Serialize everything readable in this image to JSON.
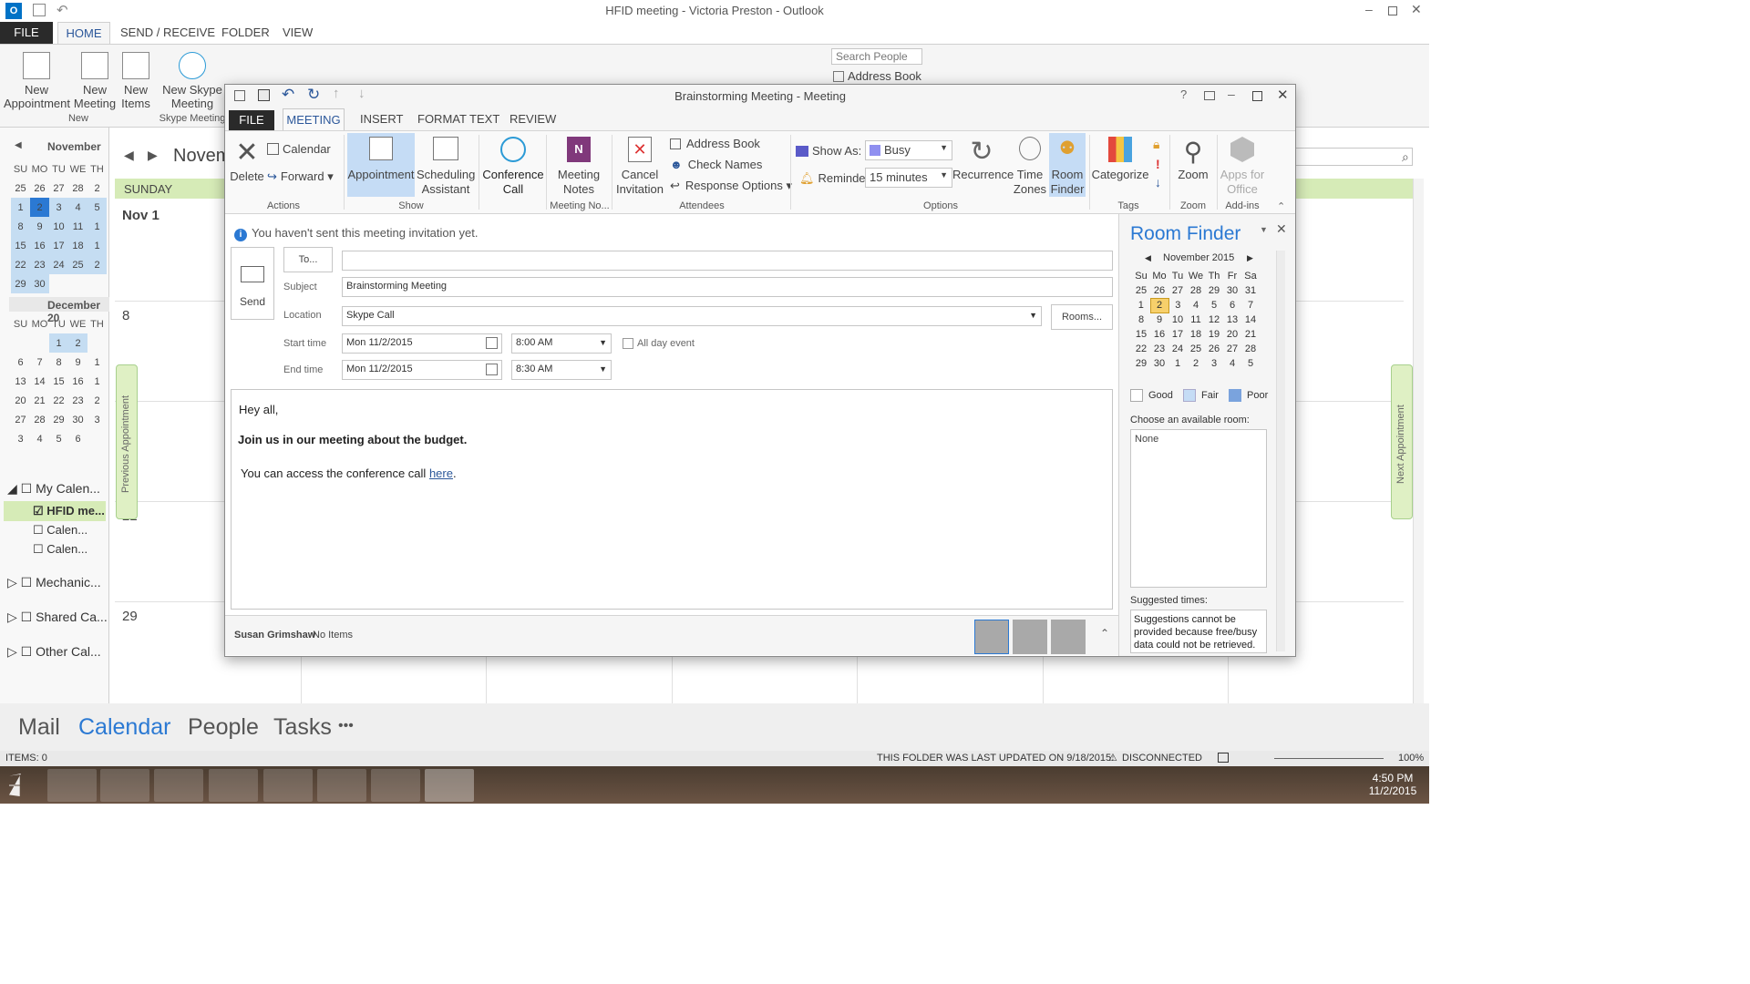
{
  "outlook": {
    "window_title": "HFID meeting - Victoria Preston - Outlook",
    "tabs": [
      "FILE",
      "HOME",
      "SEND / RECEIVE",
      "FOLDER",
      "VIEW"
    ],
    "ribbon": {
      "new_appointment": "New Appointment",
      "new_meeting": "New Meeting",
      "new_items": "New Items",
      "new_skype": "New Skype Meeting",
      "group_new": "New",
      "group_skype": "Skype Meeting",
      "search_people": "Search People",
      "address_book": "Address Book"
    },
    "nav_month1": "November",
    "nav_month2": "December 20",
    "day_headers": [
      "SU",
      "MO",
      "TU",
      "WE",
      "TH"
    ],
    "nov_weeks": [
      [
        "25",
        "26",
        "27",
        "28",
        "2"
      ],
      [
        "1",
        "2",
        "3",
        "4",
        "5"
      ],
      [
        "8",
        "9",
        "10",
        "11",
        "1"
      ],
      [
        "15",
        "16",
        "17",
        "18",
        "1"
      ],
      [
        "22",
        "23",
        "24",
        "25",
        "2"
      ],
      [
        "29",
        "30",
        "",
        "",
        ""
      ]
    ],
    "dec_weeks": [
      [
        "",
        "",
        "1",
        "2",
        ""
      ],
      [
        "6",
        "7",
        "8",
        "9",
        "1"
      ],
      [
        "13",
        "14",
        "15",
        "16",
        "1"
      ],
      [
        "20",
        "21",
        "22",
        "23",
        "2"
      ],
      [
        "27",
        "28",
        "29",
        "30",
        "3"
      ],
      [
        "3",
        "4",
        "5",
        "6",
        ""
      ]
    ],
    "calendars": {
      "my": "My Calen...",
      "hfid": "HFID me...",
      "cal1": "Calen...",
      "cal2": "Calen...",
      "mech": "Mechanic...",
      "shared": "Shared Ca...",
      "other": "Other Cal..."
    },
    "cal_month": "Novem",
    "sunday": "SUNDAY",
    "dates": [
      "Nov 1",
      "8",
      "22",
      "29"
    ],
    "prev_appt": "Previous Appointment",
    "next_appt": "Next Appointment",
    "nav": {
      "mail": "Mail",
      "calendar": "Calendar",
      "people": "People",
      "tasks": "Tasks",
      "more": "•••"
    },
    "status": {
      "items": "ITEMS: 0",
      "updated": "THIS FOLDER WAS LAST UPDATED ON 9/18/2015.",
      "disconnected": "DISCONNECTED",
      "zoom": "100%"
    },
    "clock": {
      "time": "4:50 PM",
      "date": "11/2/2015"
    }
  },
  "meeting": {
    "title": "Brainstorming Meeting - Meeting",
    "tabs": {
      "file": "FILE",
      "meeting": "MEETING",
      "insert": "INSERT",
      "format": "FORMAT TEXT",
      "review": "REVIEW"
    },
    "ribbon": {
      "delete": "Delete",
      "calendar": "Calendar",
      "forward": "Forward",
      "appointment": "Appointment",
      "scheduling": "Scheduling Assistant",
      "conference": "Conference Call",
      "notes": "Meeting Notes",
      "cancel": "Cancel Invitation",
      "address_book": "Address Book",
      "check_names": "Check Names",
      "response": "Response Options",
      "show_as_label": "Show As:",
      "show_as": "Busy",
      "reminder_label": "Reminder:",
      "reminder": "15 minutes",
      "recurrence": "Recurrence",
      "time_zones": "Time Zones",
      "room_finder": "Room Finder",
      "categorize": "Categorize",
      "zoom": "Zoom",
      "apps": "Apps for Office",
      "groups": {
        "actions": "Actions",
        "show": "Show",
        "notes": "Meeting No...",
        "attendees": "Attendees",
        "options": "Options",
        "tags": "Tags",
        "zoom": "Zoom",
        "addins": "Add-ins"
      }
    },
    "info": "You haven't sent this meeting invitation yet.",
    "send": "Send",
    "to_button": "To...",
    "to_value": "",
    "subject_label": "Subject",
    "subject": "Brainstorming Meeting",
    "location_label": "Location",
    "location": "Skype Call",
    "rooms_button": "Rooms...",
    "start_label": "Start time",
    "start_date": "Mon 11/2/2015",
    "start_time": "8:00 AM",
    "end_label": "End time",
    "end_date": "Mon 11/2/2015",
    "end_time": "8:30 AM",
    "all_day": "All day event",
    "body": {
      "greeting": "Hey all,",
      "line": "Join us in our meeting about the budget.",
      "access": "You can access the conference call ",
      "link": "here",
      "period": "."
    },
    "people_name": "Susan Grimshaw",
    "people_status": "No Items"
  },
  "room_finder": {
    "title": "Room Finder",
    "month": "November 2015",
    "days": [
      "Su",
      "Mo",
      "Tu",
      "We",
      "Th",
      "Fr",
      "Sa"
    ],
    "weeks": [
      [
        "25",
        "26",
        "27",
        "28",
        "29",
        "30",
        "31"
      ],
      [
        "1",
        "2",
        "3",
        "4",
        "5",
        "6",
        "7"
      ],
      [
        "8",
        "9",
        "10",
        "11",
        "12",
        "13",
        "14"
      ],
      [
        "15",
        "16",
        "17",
        "18",
        "19",
        "20",
        "21"
      ],
      [
        "22",
        "23",
        "24",
        "25",
        "26",
        "27",
        "28"
      ],
      [
        "29",
        "30",
        "1",
        "2",
        "3",
        "4",
        "5"
      ]
    ],
    "good": "Good",
    "fair": "Fair",
    "poor": "Poor",
    "choose": "Choose an available room:",
    "room": "None",
    "suggested": "Suggested times:",
    "suggest_text": "Suggestions cannot be provided because free/busy data could not be retrieved."
  },
  "colors": {
    "accent": "#2b579a",
    "busy": "#8f8ff0",
    "selected_day": "#f7d06b",
    "sunday_bar": "#d6ebb7"
  }
}
